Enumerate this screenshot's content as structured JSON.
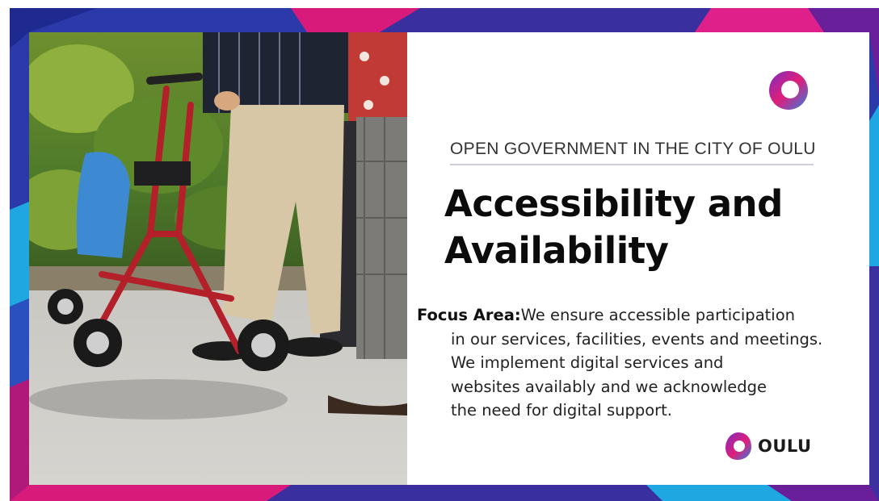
{
  "slide": {
    "kicker": "OPEN GOVERNMENT IN THE CITY OF OULU",
    "title_line_1": "Accessibility and",
    "title_line_2": "Availability",
    "focus_label": "Focus Area:",
    "focus_lines": [
      "We ensure accessible participation",
      "in our services, facilities, events and meetings.",
      "We implement digital services and",
      "websites availably and we acknowledge",
      "the need for digital support."
    ],
    "brand_word": "OULU"
  },
  "photo": {
    "subject": "person walking with a red rollator walker"
  },
  "colors": {
    "border_blue": "#2b3aa8",
    "border_magenta": "#d81b7a",
    "border_purple": "#6a1f9a",
    "border_cyan": "#1ea7e1",
    "text_dark": "#0b0b0b",
    "walker_red": "#b3202a"
  },
  "icons": {
    "top_logo": "oulu-ring-logo-icon",
    "bottom_logo": "oulu-leaf-logo-icon"
  }
}
